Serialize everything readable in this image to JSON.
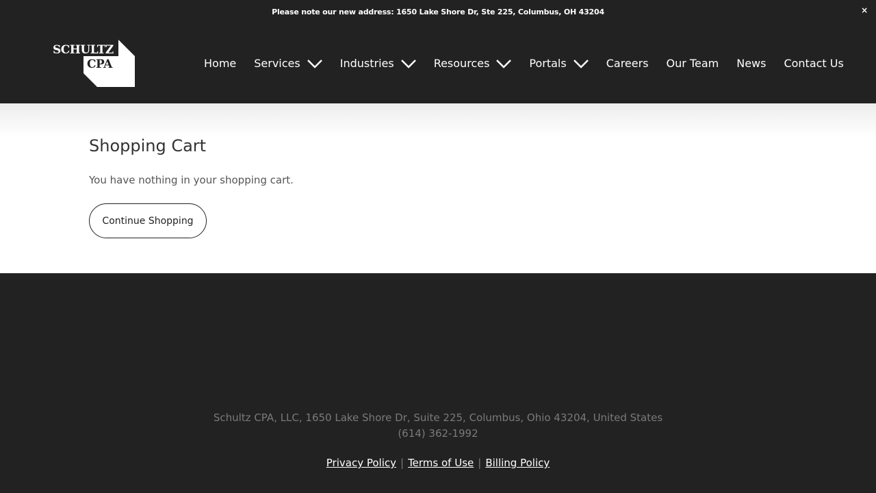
{
  "announcement": {
    "text": "Please note our new address: 1650 Lake Shore Dr, Ste 225, Columbus, OH 43204",
    "close_label": "×"
  },
  "logo": {
    "line1": "SCHULTZ",
    "line2": "CPA"
  },
  "nav": {
    "items": [
      {
        "label": "Home",
        "has_dropdown": false
      },
      {
        "label": "Services",
        "has_dropdown": true
      },
      {
        "label": "Industries",
        "has_dropdown": true
      },
      {
        "label": "Resources",
        "has_dropdown": true
      },
      {
        "label": "Portals",
        "has_dropdown": true
      },
      {
        "label": "Careers",
        "has_dropdown": false
      },
      {
        "label": "Our Team",
        "has_dropdown": false
      },
      {
        "label": "News",
        "has_dropdown": false
      },
      {
        "label": "Contact Us",
        "has_dropdown": false
      }
    ]
  },
  "cart": {
    "title": "Shopping Cart",
    "empty_message": "You have nothing in your shopping cart.",
    "continue_label": "Continue Shopping"
  },
  "footer": {
    "address": "Schultz CPA, LLC, 1650 Lake Shore Dr, Suite 225, Columbus, Ohio 43204, United States",
    "phone": "(614) 362-1992",
    "links": [
      "Privacy Policy",
      "Terms of Use",
      "Billing Policy"
    ],
    "separator": "|"
  },
  "colors": {
    "dark_bg": "#222222",
    "white": "#ffffff",
    "muted_text": "#7a7a7a"
  }
}
